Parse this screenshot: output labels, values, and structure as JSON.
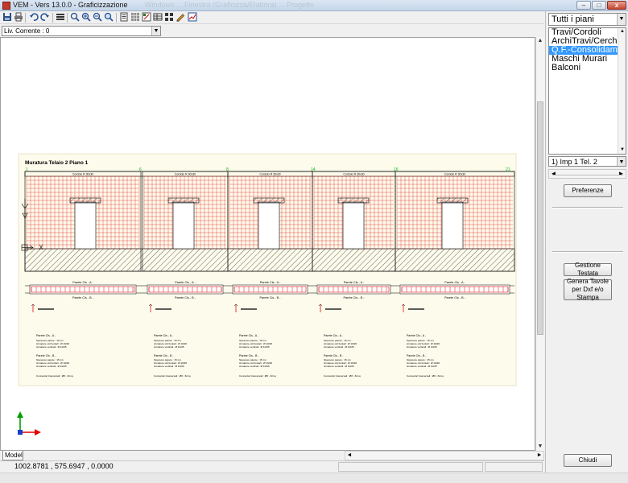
{
  "window": {
    "title": "VEM - Vers 13.0.0 - Graficizzazione",
    "ghost_title": "Windows ... Finestra (Graficizza/Elabora) ... Progetto",
    "minimize": "–",
    "maximize": "□",
    "close": "x"
  },
  "toolbar": {
    "icons": [
      "save-icon",
      "print-icon",
      "undo-icon",
      "redo-icon",
      "layers-icon",
      "zoom-window-icon",
      "zoom-in-icon",
      "zoom-out-icon",
      "zoom-all-icon",
      "print-preview-icon",
      "grid-icon",
      "dimension-icon",
      "table-icon",
      "list-icon",
      "block-icon",
      "pencil-icon",
      "chart-icon"
    ]
  },
  "level_selector": {
    "value": "Liv. Corrente : 0"
  },
  "drawing": {
    "title": "Muratura Telaio 2 Piano 1",
    "node_labels": [
      "1",
      "6",
      "8",
      "14",
      "16",
      "21"
    ],
    "panel_headers": [
      "Cordolo R 30x30",
      "Cordolo R 30x30",
      "Cordolo R 30x30",
      "Cordolo R 30x30",
      "Cordolo R 30x30"
    ],
    "plan_labels_top": [
      "Parete Cls - A -",
      "Parete Cls - A -",
      "Parete Cls - A -",
      "Parete Cls - A -",
      "Parete Cls - A -"
    ],
    "plan_labels_bottom": [
      "Parete Cls - B -",
      "Parete Cls - B -",
      "Parete Cls - B -",
      "Parete Cls - B -",
      "Parete Cls - B -"
    ],
    "notes": {
      "a_title": "Parete Cls - A -",
      "a_line1": "Spessore parete : 15 cm",
      "a_line2": "Armature orizzontali : Ø 10/20",
      "a_line3": "Armature verticali : Ø 10/25",
      "b_title": "Parete Cls - B -",
      "b_line1": "Spessore parete : 15 cm",
      "b_line2": "Armature orizzontali : Ø 10/20",
      "b_line3": "Armature verticali : Ø 10/25",
      "connectors": "Connettori trasversali : Ø8 - 6/mq"
    }
  },
  "canvas": {
    "model_tab": "Model",
    "coordinates": "1002.8781 , 575.6947 , 0.0000"
  },
  "right_panel": {
    "floors_combo": "Tutti i piani",
    "elements": [
      {
        "label": "Travi/Cordoli",
        "selected": false
      },
      {
        "label": "ArchiTravi/Cerchiature",
        "selected": false
      },
      {
        "label": "Q.F.-Consolidamenti",
        "selected": true
      },
      {
        "label": "Maschi Murari",
        "selected": false
      },
      {
        "label": "Balconi",
        "selected": false
      }
    ],
    "frame_combo": "1) Imp 1 Tel. 2",
    "preferences_button": "Preferenze",
    "header_button": "Gestione Testata",
    "generate_button": "Genera Tavole per Dxf e/o Stampa",
    "close_button": "Chiudi"
  },
  "colors": {
    "grid_red": "#e01010",
    "line_dark": "#000000",
    "node_green": "#00bb00",
    "selection_blue": "#3399ff",
    "axis_x_red": "#e00000",
    "axis_y_green": "#00a000",
    "axis_z_blue": "#1a3cc8"
  }
}
